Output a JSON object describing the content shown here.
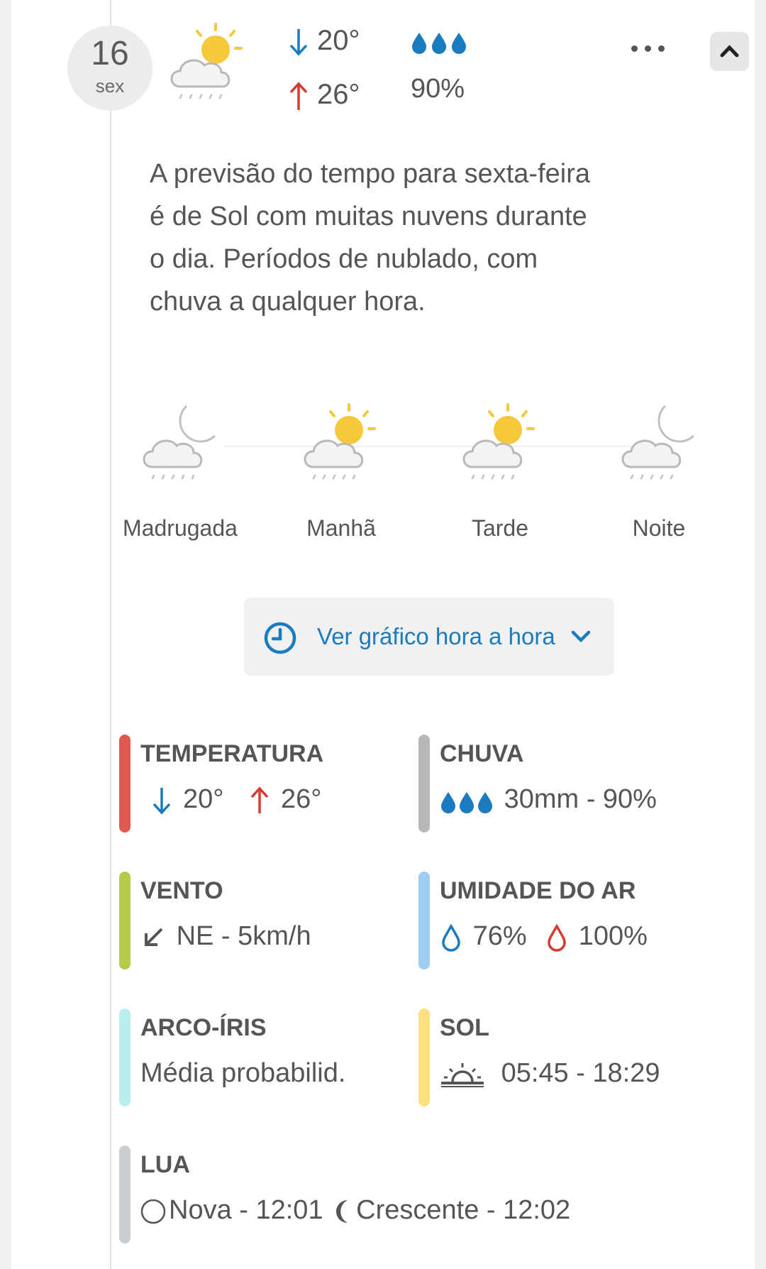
{
  "day": {
    "number": "16",
    "weekday": "sex"
  },
  "header": {
    "temp_min": "20°",
    "temp_max": "26°",
    "rain_pct": "90%"
  },
  "description": "A previsão do tempo para sexta-feira é de Sol com muitas nuvens durante o dia. Períodos de nublado, com chuva a qualquer hora.",
  "periods": [
    {
      "label": "Madrugada",
      "icon": "moon-cloud-rain-icon"
    },
    {
      "label": "Manhã",
      "icon": "sun-cloud-rain-icon"
    },
    {
      "label": "Tarde",
      "icon": "sun-cloud-rain-icon"
    },
    {
      "label": "Noite",
      "icon": "moon-cloud-rain-icon"
    }
  ],
  "hourly_button": {
    "label": "Ver gráfico hora a hora"
  },
  "stats": {
    "temperature": {
      "title": "TEMPERATURA",
      "min": "20°",
      "max": "26°",
      "color": "#e05a52"
    },
    "rain": {
      "title": "CHUVA",
      "value": "30mm - 90%",
      "color": "#b8b8b8"
    },
    "wind": {
      "title": "VENTO",
      "value": "NE - 5km/h",
      "color": "#b5cc4a"
    },
    "humidity": {
      "title": "UMIDADE DO AR",
      "min": "76%",
      "max": "100%",
      "color": "#9ccef2"
    },
    "rainbow": {
      "title": "ARCO-ÍRIS",
      "value": "Média probabilid.",
      "color": "#b9eef0"
    },
    "sun": {
      "title": "SOL",
      "value": "05:45 - 18:29",
      "color": "#fbe07c"
    },
    "moon": {
      "title": "LUA",
      "new": "Nova - 12:01",
      "crescent": "Crescente - 12:02",
      "color": "#c8ced2"
    }
  },
  "colors": {
    "blue": "#1a7bbf",
    "red": "#d63b2f",
    "sun": "#f6c93c"
  }
}
